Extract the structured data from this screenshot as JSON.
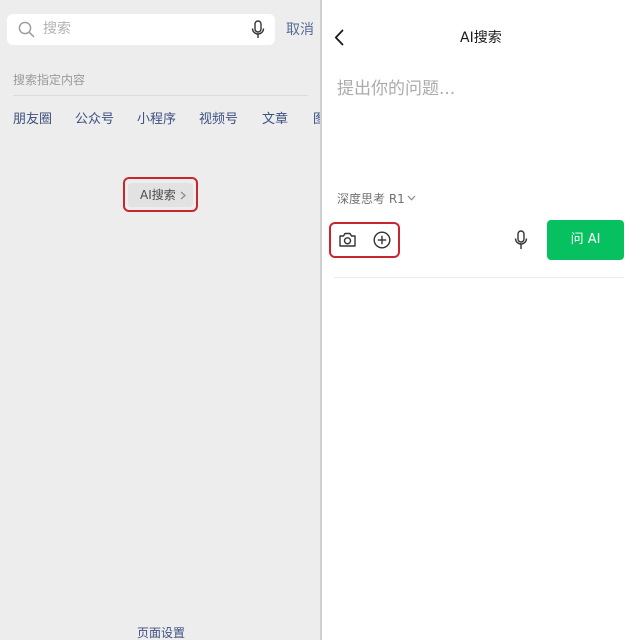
{
  "left_panel": {
    "search": {
      "placeholder": "搜索",
      "cancel_label": "取消"
    },
    "specified_search": {
      "title": "搜索指定内容",
      "categories": [
        "朋友圈",
        "公众号",
        "小程序",
        "视频号",
        "文章",
        "图"
      ]
    },
    "ai_search_button": {
      "label": "AI搜索",
      "chevron_icon": "chevron-right-icon"
    },
    "footer": {
      "page_settings_label": "页面设置"
    }
  },
  "right_panel": {
    "header": {
      "title": "AI搜索",
      "back_icon": "back-arrow-icon"
    },
    "question_placeholder": "提出你的问题...",
    "mode": {
      "label": "深度思考 R1",
      "icon": "chevron-down-icon"
    },
    "toolbar": {
      "camera_icon": "camera-icon",
      "add_icon": "plus-circle-icon",
      "mic_icon": "microphone-icon",
      "ask_button_label": "问 AI"
    }
  },
  "colors": {
    "accent_green": "#07c160",
    "link_blue": "#576b95",
    "highlight_red": "#c8252c",
    "left_bg": "#ededed"
  }
}
